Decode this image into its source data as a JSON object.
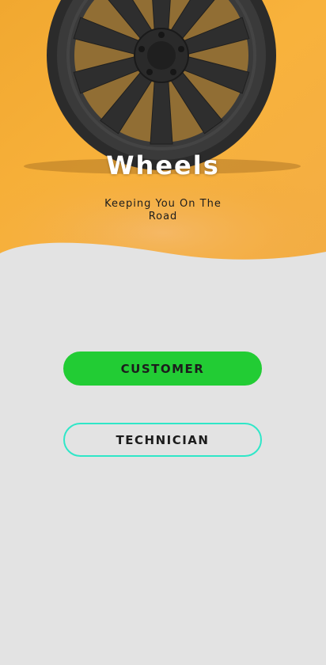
{
  "app": {
    "title": "Wheels",
    "tagline": "Keeping You On The Road"
  },
  "actions": {
    "customer_label": "CUSTOMER",
    "technician_label": "TECHNICIAN"
  },
  "colors": {
    "background": "#e3e3e3",
    "hero_orange": "#f6ad3a",
    "customer_button": "#22cc34",
    "technician_outline": "#2fe7c8"
  },
  "hero_image": "alloy-wheel-photo"
}
